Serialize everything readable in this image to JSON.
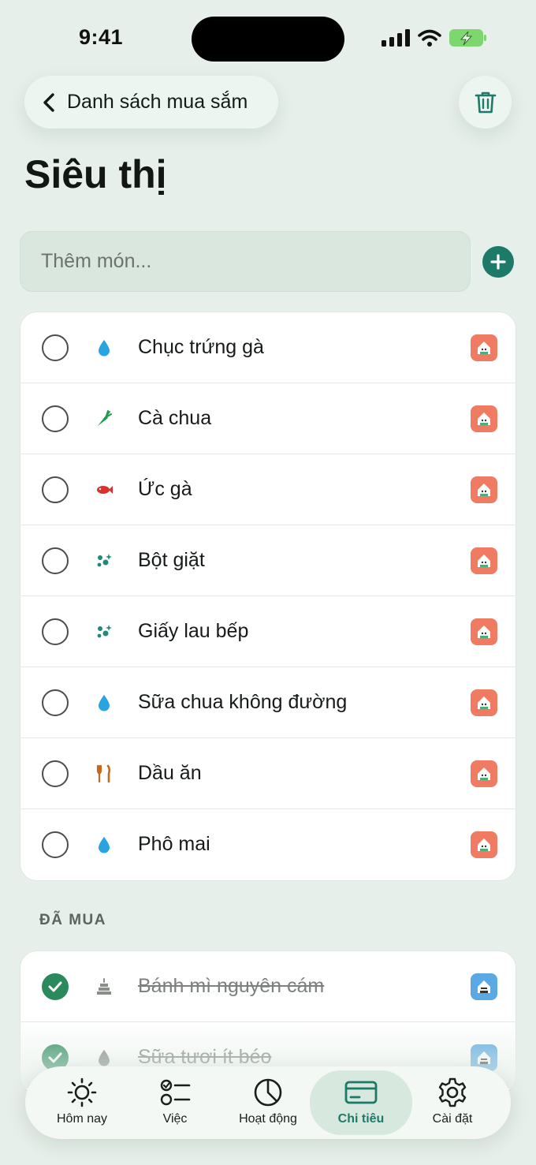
{
  "status": {
    "time": "9:41"
  },
  "header": {
    "back_label": "Danh sách mua sắm"
  },
  "page": {
    "title": "Siêu thị"
  },
  "add": {
    "placeholder": "Thêm món..."
  },
  "items": [
    {
      "label": "Chục trứng gà",
      "icon": "drop-icon"
    },
    {
      "label": "Cà chua",
      "icon": "carrot-icon"
    },
    {
      "label": "Ức gà",
      "icon": "fish-icon"
    },
    {
      "label": "Bột giặt",
      "icon": "sparkle-icon"
    },
    {
      "label": "Giấy lau bếp",
      "icon": "sparkle-icon"
    },
    {
      "label": "Sữa chua không đường",
      "icon": "drop-icon"
    },
    {
      "label": "Dầu ăn",
      "icon": "fork-knife-icon"
    },
    {
      "label": "Phô mai",
      "icon": "drop-icon"
    }
  ],
  "bought": {
    "header": "ĐÃ MUA",
    "items": [
      {
        "label": "Bánh mì nguyên cám",
        "icon": "cake-icon"
      },
      {
        "label": "Sữa tươi ít béo",
        "icon": "drop-icon"
      }
    ]
  },
  "tabs": [
    {
      "label": "Hôm nay",
      "icon": "sun-icon"
    },
    {
      "label": "Việc",
      "icon": "checklist-icon"
    },
    {
      "label": "Hoạt động",
      "icon": "pie-chart-icon"
    },
    {
      "label": "Chi tiêu",
      "icon": "card-icon"
    },
    {
      "label": "Cài đặt",
      "icon": "gear-icon"
    }
  ],
  "colors": {
    "accent": "#1d7a68",
    "checked": "#2a8a5c",
    "avatar_orange": "#ef7b63",
    "avatar_blue": "#5aa8e4",
    "background": "#e6efe9"
  }
}
